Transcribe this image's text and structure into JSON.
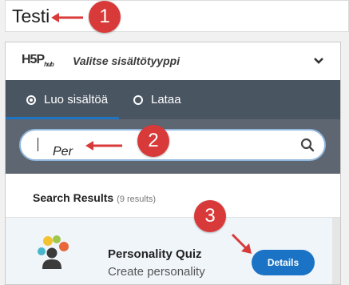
{
  "title_field": {
    "value": "Testi"
  },
  "hub": {
    "logo": "H5P",
    "logo_sub": "hub",
    "title": "Valitse sisältötyyppi"
  },
  "tabs": [
    {
      "label": "Luo sisältöä",
      "selected": true
    },
    {
      "label": "Lataa",
      "selected": false
    }
  ],
  "search": {
    "value": "Per"
  },
  "results": {
    "heading": "Search Results",
    "count": "(9 results)",
    "items": [
      {
        "title": "Personality Quiz",
        "description": "Create personality",
        "button": "Details"
      }
    ]
  },
  "annotations": {
    "step1": "1",
    "step2": "2",
    "step3": "3"
  },
  "colors": {
    "accent": "#1a73c5",
    "tabs_bg": "#4a5562",
    "badge": "#d83a3a"
  }
}
